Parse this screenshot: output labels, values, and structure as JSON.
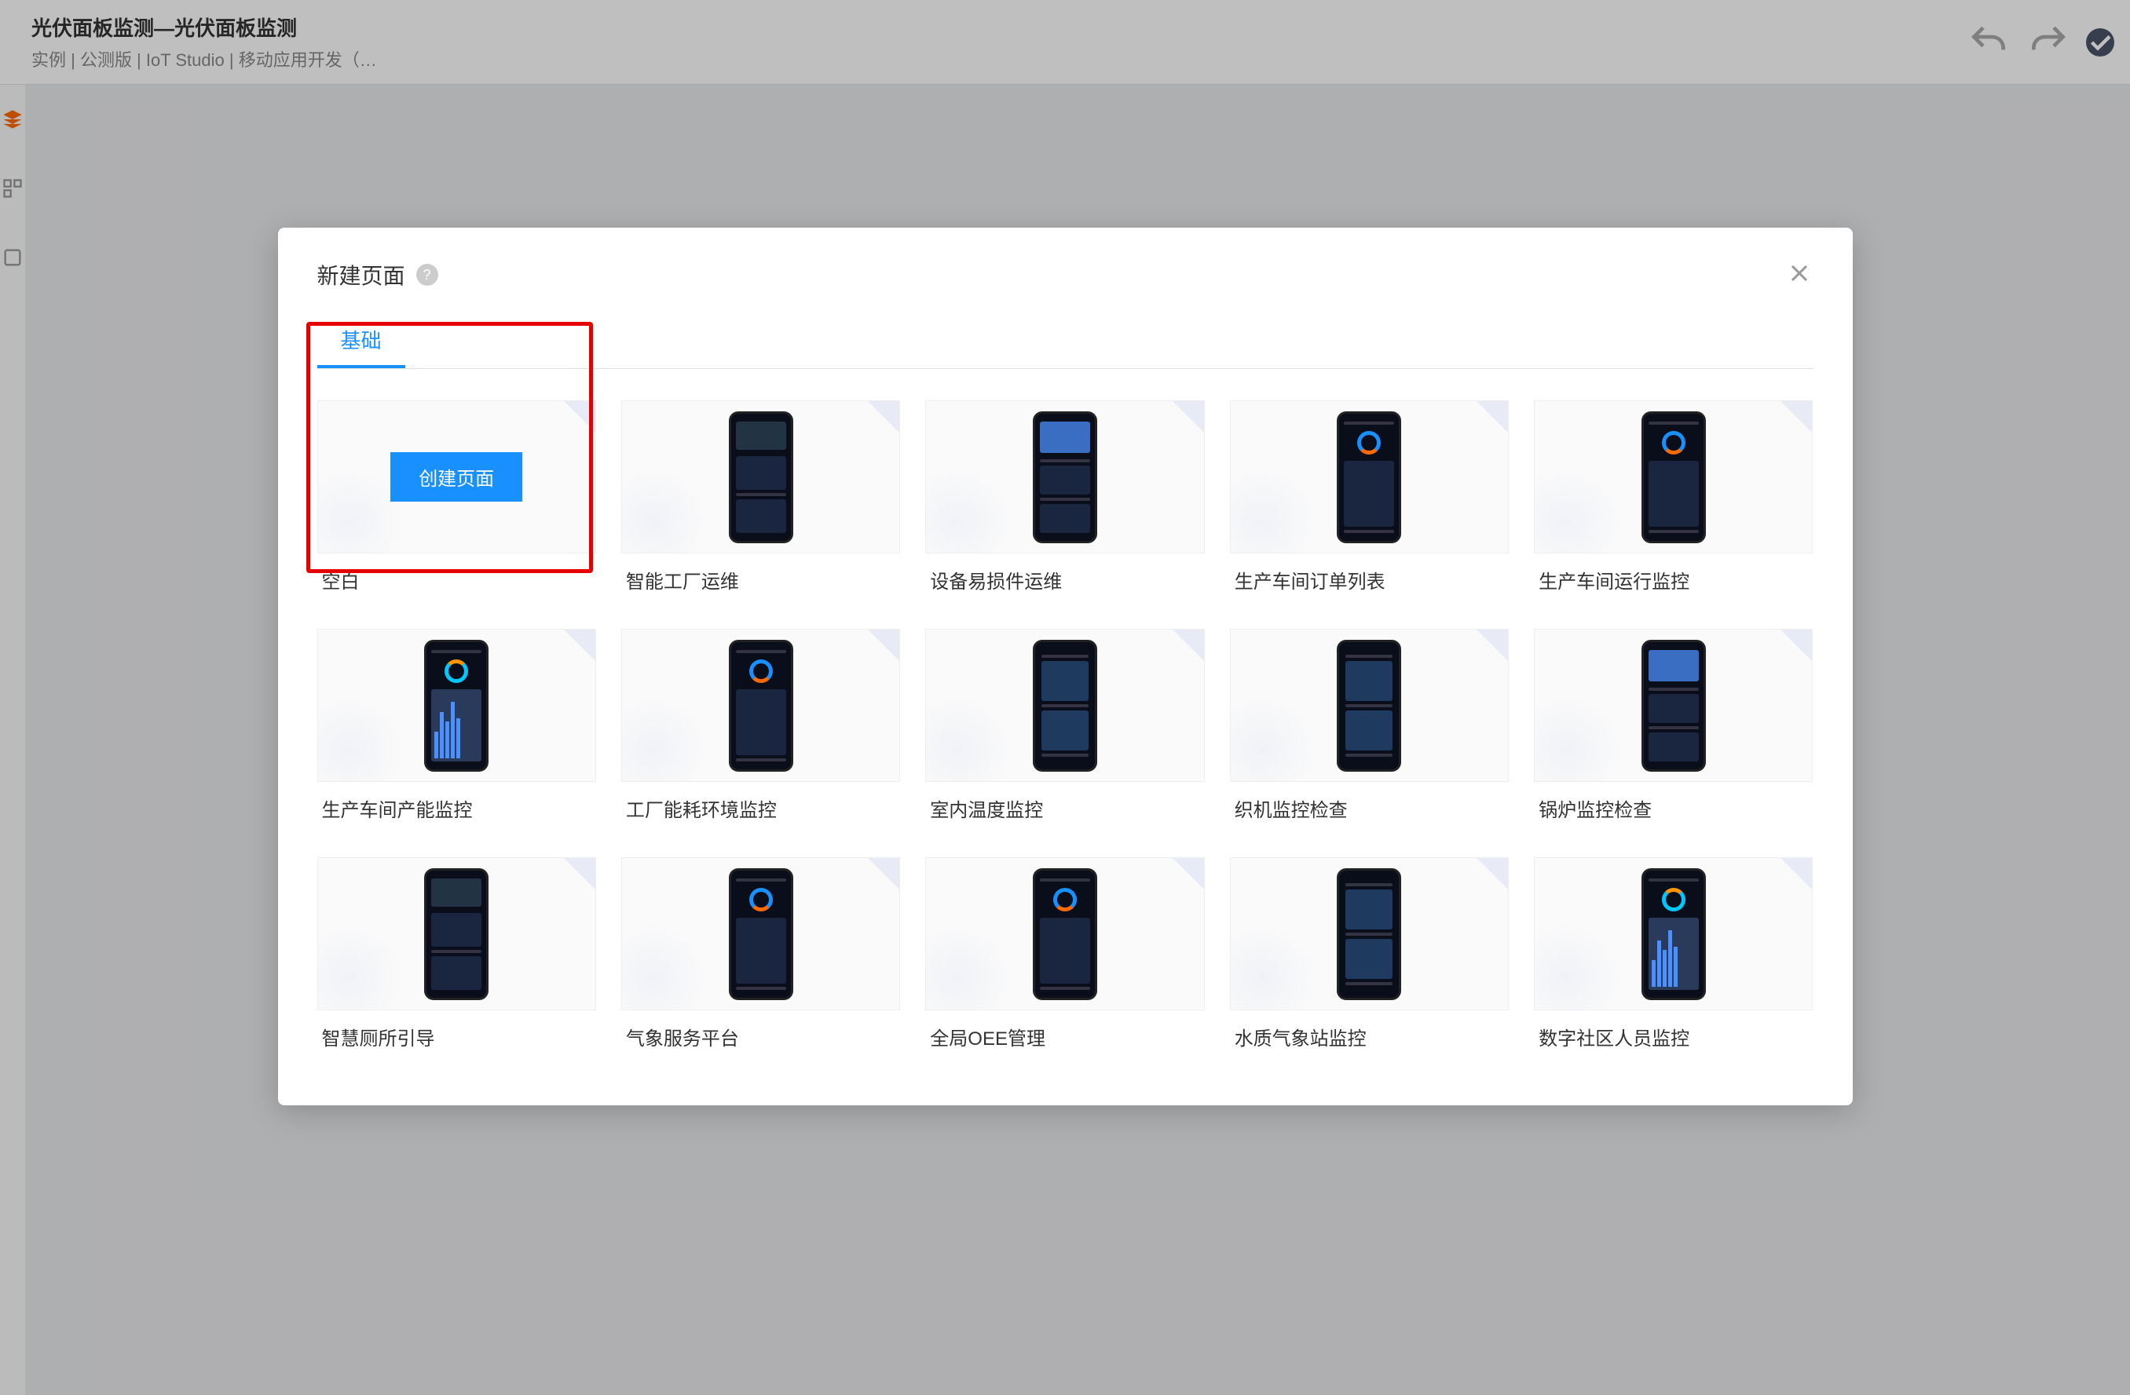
{
  "header": {
    "title": "光伏面板监测—光伏面板监测",
    "subtitle": "实例 | 公测版 | IoT Studio | 移动应用开发（…"
  },
  "modal": {
    "title": "新建页面",
    "tab": "基础",
    "create_button": "创建页面",
    "templates": [
      {
        "name": "空白",
        "is_blank": true
      },
      {
        "name": "智能工厂运维",
        "variant": "variant-6"
      },
      {
        "name": "设备易损件运维",
        "variant": "variant-5"
      },
      {
        "name": "生产车间订单列表",
        "variant": "variant-2"
      },
      {
        "name": "生产车间运行监控",
        "variant": "variant-2"
      },
      {
        "name": "生产车间产能监控",
        "variant": "variant-4"
      },
      {
        "name": "工厂能耗环境监控",
        "variant": "variant-2"
      },
      {
        "name": "室内温度监控",
        "variant": "variant-3"
      },
      {
        "name": "织机监控检查",
        "variant": "variant-3"
      },
      {
        "name": "锅炉监控检查",
        "variant": "variant-5"
      },
      {
        "name": "智慧厕所引导",
        "variant": "variant-6"
      },
      {
        "name": "气象服务平台",
        "variant": "variant-2"
      },
      {
        "name": "全局OEE管理",
        "variant": "variant-2"
      },
      {
        "name": "水质气象站监控",
        "variant": "variant-3"
      },
      {
        "name": "数字社区人员监控",
        "variant": "variant-4"
      }
    ]
  }
}
